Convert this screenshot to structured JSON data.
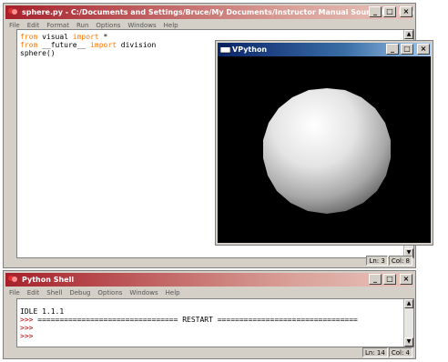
{
  "editor": {
    "title": "sphere.py - C:/Documents and Settings/Bruce/My Documents/Instructor Manual Source/MM handouts/V...",
    "menu": [
      "File",
      "Edit",
      "Format",
      "Run",
      "Options",
      "Windows",
      "Help"
    ],
    "code": {
      "line1_kw1": "from",
      "line1_mid": " visual ",
      "line1_kw2": "import",
      "line1_end": " *",
      "line2_kw1": "from",
      "line2_mid": " __future__ ",
      "line2_kw2": "import",
      "line2_end": " division",
      "line3": "sphere()"
    },
    "status_ln": "Ln: 3",
    "status_col": "Col: 8"
  },
  "vpython": {
    "title": "VPython",
    "scene_background": "#000000",
    "sphere_color": "#ffffff"
  },
  "shell": {
    "title": "Python Shell",
    "menu": [
      "File",
      "Edit",
      "Shell",
      "Debug",
      "Options",
      "Windows",
      "Help"
    ],
    "line1": "IDLE 1.1.1",
    "prompt": ">>>",
    "restart_line": " ================================ RESTART ================================",
    "status_ln": "Ln: 14",
    "status_col": "Col: 4"
  },
  "colors": {
    "active_title": "#a6202a",
    "keyword": "#ff7700",
    "prompt": "#c00000"
  },
  "icons": {
    "minimize": "_",
    "maximize": "□",
    "close": "×",
    "scroll_up": "▲",
    "scroll_down": "▼"
  }
}
